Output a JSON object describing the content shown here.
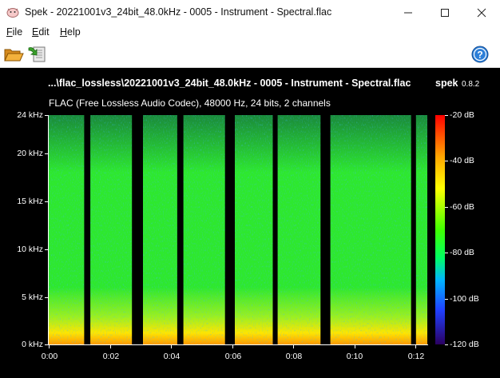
{
  "window": {
    "title": "Spek - 20221001v3_24bit_48.0kHz - 0005 - Instrument - Spectral.flac",
    "minimize_label": "Minimize",
    "maximize_label": "Maximize",
    "close_label": "Close"
  },
  "menu": {
    "file": {
      "accel": "F",
      "rest": "ile"
    },
    "edit": {
      "accel": "E",
      "rest": "dit"
    },
    "help": {
      "accel": "H",
      "rest": "elp"
    }
  },
  "toolbar": {
    "open_icon": "folder-open-icon",
    "save_icon": "save-arrow-icon",
    "help_icon": "help-circle-icon"
  },
  "spectrogram": {
    "file_path": "...\\flac_lossless\\20221001v3_24bit_48.0kHz - 0005 - Instrument - Spectral.flac",
    "brand": "spek",
    "version": "0.8.2",
    "info": "FLAC (Free Lossless Audio Codec), 48000 Hz, 24 bits, 2 channels",
    "freq_ticks": [
      "24 kHz",
      "20 kHz",
      "15 kHz",
      "10 kHz",
      "5 kHz",
      "0 kHz"
    ],
    "freq_values": [
      24,
      20,
      15,
      10,
      5,
      0
    ],
    "time_ticks": [
      "0:00",
      "0:02",
      "0:04",
      "0:06",
      "0:08",
      "0:10",
      "0:12"
    ],
    "time_values": [
      0,
      2,
      4,
      6,
      8,
      10,
      12
    ],
    "db_ticks": [
      "-20 dB",
      "-40 dB",
      "-60 dB",
      "-80 dB",
      "-100 dB",
      "-120 dB"
    ],
    "db_values": [
      -20,
      -40,
      -60,
      -80,
      -100,
      -120
    ],
    "silence_gaps_seconds": [
      [
        1.16,
        1.36
      ],
      [
        2.72,
        3.08
      ],
      [
        4.2,
        4.4
      ],
      [
        5.76,
        6.08
      ],
      [
        7.32,
        7.48
      ],
      [
        8.88,
        9.2
      ],
      [
        11.84,
        12.0
      ]
    ],
    "duration_seconds": 12.37,
    "colors": {
      "low": "#1a8a3a",
      "mid": "#2ee82e",
      "high": "#ffe600",
      "peak": "#ff3a00"
    }
  }
}
